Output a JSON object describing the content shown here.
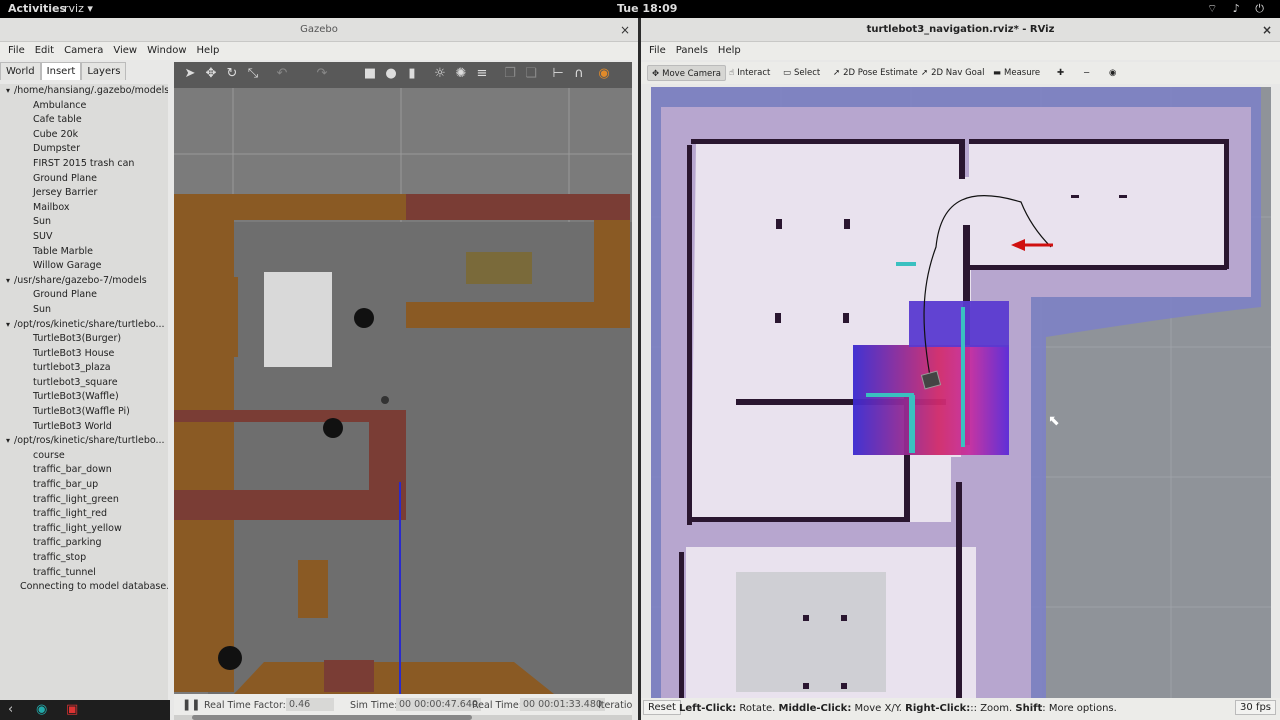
{
  "topbar": {
    "activities": "Activities",
    "app_menu": "rviz ▾",
    "clock": "Tue 18:09",
    "system_icons": "⌔ ♪ ⏻"
  },
  "gazebo": {
    "title": "Gazebo",
    "close": "×",
    "menu": [
      "File",
      "Edit",
      "Camera",
      "View",
      "Window",
      "Help"
    ],
    "tabs": [
      "World",
      "Insert",
      "Layers"
    ],
    "tree": [
      {
        "kind": "grp",
        "label": "/home/hansiang/.gazebo/models"
      },
      {
        "kind": "item",
        "label": "Ambulance"
      },
      {
        "kind": "item",
        "label": "Cafe table"
      },
      {
        "kind": "item",
        "label": "Cube 20k"
      },
      {
        "kind": "item",
        "label": "Dumpster"
      },
      {
        "kind": "item",
        "label": "FIRST 2015 trash can"
      },
      {
        "kind": "item",
        "label": "Ground Plane"
      },
      {
        "kind": "item",
        "label": "Jersey Barrier"
      },
      {
        "kind": "item",
        "label": "Mailbox"
      },
      {
        "kind": "item",
        "label": "Sun"
      },
      {
        "kind": "item",
        "label": "SUV"
      },
      {
        "kind": "item",
        "label": "Table Marble"
      },
      {
        "kind": "item",
        "label": "Willow Garage"
      },
      {
        "kind": "grp",
        "label": "/usr/share/gazebo-7/models"
      },
      {
        "kind": "item",
        "label": "Ground Plane"
      },
      {
        "kind": "item",
        "label": "Sun"
      },
      {
        "kind": "grp",
        "label": "/opt/ros/kinetic/share/turtlebo..."
      },
      {
        "kind": "item",
        "label": "TurtleBot3(Burger)"
      },
      {
        "kind": "item",
        "label": "TurtleBot3 House"
      },
      {
        "kind": "item",
        "label": "turtlebot3_plaza"
      },
      {
        "kind": "item",
        "label": "turtlebot3_square"
      },
      {
        "kind": "item",
        "label": "TurtleBot3(Waffle)"
      },
      {
        "kind": "item",
        "label": "TurtleBot3(Waffle Pi)"
      },
      {
        "kind": "item",
        "label": "TurtleBot3 World"
      },
      {
        "kind": "grp",
        "label": "/opt/ros/kinetic/share/turtlebo..."
      },
      {
        "kind": "item",
        "label": "course"
      },
      {
        "kind": "item",
        "label": "traffic_bar_down"
      },
      {
        "kind": "item",
        "label": "traffic_bar_up"
      },
      {
        "kind": "item",
        "label": "traffic_light_green"
      },
      {
        "kind": "item",
        "label": "traffic_light_red"
      },
      {
        "kind": "item",
        "label": "traffic_light_yellow"
      },
      {
        "kind": "item",
        "label": "traffic_parking"
      },
      {
        "kind": "item",
        "label": "traffic_stop"
      },
      {
        "kind": "item",
        "label": "traffic_tunnel"
      },
      {
        "kind": "status",
        "label": "Connecting to model database..."
      }
    ],
    "bottom": {
      "rtf_label": "Real Time Factor:",
      "rtf_value": "0.46",
      "sim_label": "Sim Time:",
      "sim_value": "00 00:00:47.640",
      "real_label": "Real Time:",
      "real_value": "00 00:01:33.480",
      "iter_label": "Iteratio"
    }
  },
  "rviz": {
    "title": "turtlebot3_navigation.rviz* - RViz",
    "close": "×",
    "menu": [
      "File",
      "Panels",
      "Help"
    ],
    "tools": [
      {
        "label": "Move Camera",
        "icon": "✥"
      },
      {
        "label": "Interact",
        "icon": "☝"
      },
      {
        "label": "Select",
        "icon": "▭"
      },
      {
        "label": "2D Pose Estimate",
        "icon": "➚"
      },
      {
        "label": "2D Nav Goal",
        "icon": "➚"
      },
      {
        "label": "Measure",
        "icon": "▬"
      }
    ],
    "status": {
      "reset": "Reset",
      "help_html_parts": [
        "Left-Click:",
        " Rotate. ",
        "Middle-Click:",
        " Move X/Y. ",
        "Right-Click:",
        ":: Zoom. ",
        "Shift",
        ": More options."
      ],
      "fps": "30 fps"
    }
  }
}
